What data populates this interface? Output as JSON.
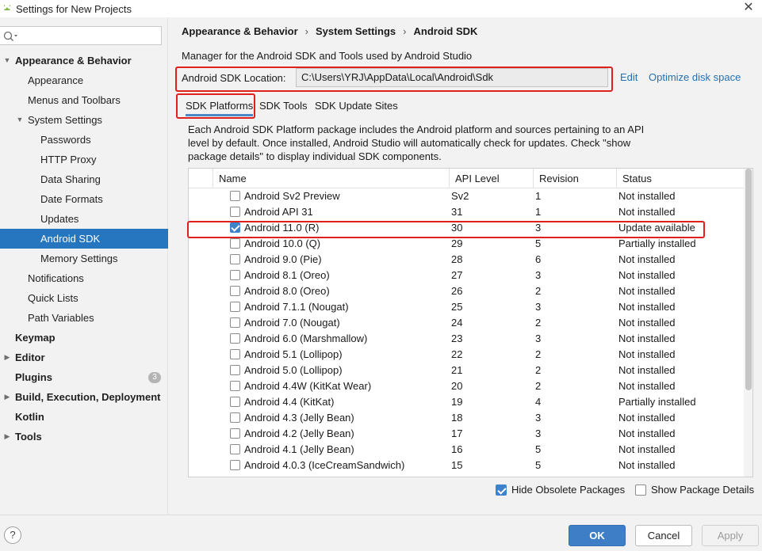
{
  "window": {
    "title": "Settings for New Projects",
    "close_glyph": "✕"
  },
  "sidebar": {
    "search_placeholder": "",
    "items": [
      {
        "label": "Appearance & Behavior",
        "level": 0,
        "bold": true,
        "arrow": "▼"
      },
      {
        "label": "Appearance",
        "level": 1
      },
      {
        "label": "Menus and Toolbars",
        "level": 1
      },
      {
        "label": "System Settings",
        "level": 1,
        "arrow": "▼"
      },
      {
        "label": "Passwords",
        "level": 2
      },
      {
        "label": "HTTP Proxy",
        "level": 2
      },
      {
        "label": "Data Sharing",
        "level": 2
      },
      {
        "label": "Date Formats",
        "level": 2
      },
      {
        "label": "Updates",
        "level": 2
      },
      {
        "label": "Android SDK",
        "level": 2,
        "selected": true
      },
      {
        "label": "Memory Settings",
        "level": 2
      },
      {
        "label": "Notifications",
        "level": 1
      },
      {
        "label": "Quick Lists",
        "level": 1
      },
      {
        "label": "Path Variables",
        "level": 1
      },
      {
        "label": "Keymap",
        "level": 0,
        "bold": true
      },
      {
        "label": "Editor",
        "level": 0,
        "bold": true,
        "arrow": "▶"
      },
      {
        "label": "Plugins",
        "level": 0,
        "bold": true,
        "badge": "3"
      },
      {
        "label": "Build, Execution, Deployment",
        "level": 0,
        "bold": true,
        "arrow": "▶"
      },
      {
        "label": "Kotlin",
        "level": 0,
        "bold": true
      },
      {
        "label": "Tools",
        "level": 0,
        "bold": true,
        "arrow": "▶"
      }
    ]
  },
  "breadcrumb": [
    "Appearance & Behavior",
    "System Settings",
    "Android SDK"
  ],
  "breadcrumb_separator": "›",
  "description": "Manager for the Android SDK and Tools used by Android Studio",
  "sdk_location": {
    "label": "Android SDK Location:",
    "value": "C:\\Users\\YRJ\\AppData\\Local\\Android\\Sdk",
    "edit_label": "Edit",
    "optimize_label": "Optimize disk space"
  },
  "tabs": [
    {
      "label": "SDK Platforms",
      "active": true
    },
    {
      "label": "SDK Tools"
    },
    {
      "label": "SDK Update Sites"
    }
  ],
  "tab_description": [
    "Each Android SDK Platform package includes the Android platform and sources pertaining to an API",
    "level by default. Once installed, Android Studio will automatically check for updates. Check \"show",
    "package details\" to display individual SDK components."
  ],
  "table": {
    "columns": [
      "Name",
      "API Level",
      "Revision",
      "Status"
    ],
    "rows": [
      {
        "checked": false,
        "name": "Android Sv2 Preview",
        "api": "Sv2",
        "rev": "1",
        "status": "Not installed"
      },
      {
        "checked": false,
        "name": "Android API 31",
        "api": "31",
        "rev": "1",
        "status": "Not installed"
      },
      {
        "checked": true,
        "name": "Android 11.0 (R)",
        "api": "30",
        "rev": "3",
        "status": "Update available"
      },
      {
        "checked": false,
        "name": "Android 10.0 (Q)",
        "api": "29",
        "rev": "5",
        "status": "Partially installed"
      },
      {
        "checked": false,
        "name": "Android 9.0 (Pie)",
        "api": "28",
        "rev": "6",
        "status": "Not installed"
      },
      {
        "checked": false,
        "name": "Android 8.1 (Oreo)",
        "api": "27",
        "rev": "3",
        "status": "Not installed"
      },
      {
        "checked": false,
        "name": "Android 8.0 (Oreo)",
        "api": "26",
        "rev": "2",
        "status": "Not installed"
      },
      {
        "checked": false,
        "name": "Android 7.1.1 (Nougat)",
        "api": "25",
        "rev": "3",
        "status": "Not installed"
      },
      {
        "checked": false,
        "name": "Android 7.0 (Nougat)",
        "api": "24",
        "rev": "2",
        "status": "Not installed"
      },
      {
        "checked": false,
        "name": "Android 6.0 (Marshmallow)",
        "api": "23",
        "rev": "3",
        "status": "Not installed"
      },
      {
        "checked": false,
        "name": "Android 5.1 (Lollipop)",
        "api": "22",
        "rev": "2",
        "status": "Not installed"
      },
      {
        "checked": false,
        "name": "Android 5.0 (Lollipop)",
        "api": "21",
        "rev": "2",
        "status": "Not installed"
      },
      {
        "checked": false,
        "name": "Android 4.4W (KitKat Wear)",
        "api": "20",
        "rev": "2",
        "status": "Not installed"
      },
      {
        "checked": false,
        "name": "Android 4.4 (KitKat)",
        "api": "19",
        "rev": "4",
        "status": "Partially installed"
      },
      {
        "checked": false,
        "name": "Android 4.3 (Jelly Bean)",
        "api": "18",
        "rev": "3",
        "status": "Not installed"
      },
      {
        "checked": false,
        "name": "Android 4.2 (Jelly Bean)",
        "api": "17",
        "rev": "3",
        "status": "Not installed"
      },
      {
        "checked": false,
        "name": "Android 4.1 (Jelly Bean)",
        "api": "16",
        "rev": "5",
        "status": "Not installed"
      },
      {
        "checked": false,
        "name": "Android 4.0.3 (IceCreamSandwich)",
        "api": "15",
        "rev": "5",
        "status": "Not installed"
      }
    ]
  },
  "options": {
    "hide_obsolete": {
      "label": "Hide Obsolete Packages",
      "checked": true
    },
    "show_details": {
      "label": "Show Package Details",
      "checked": false
    }
  },
  "buttons": {
    "help": "?",
    "ok": "OK",
    "cancel": "Cancel",
    "apply": "Apply"
  },
  "colors": {
    "selection": "#2675bf",
    "highlight_red": "#e0201c",
    "link": "#2470b3",
    "primary_button": "#3d7ec7"
  }
}
